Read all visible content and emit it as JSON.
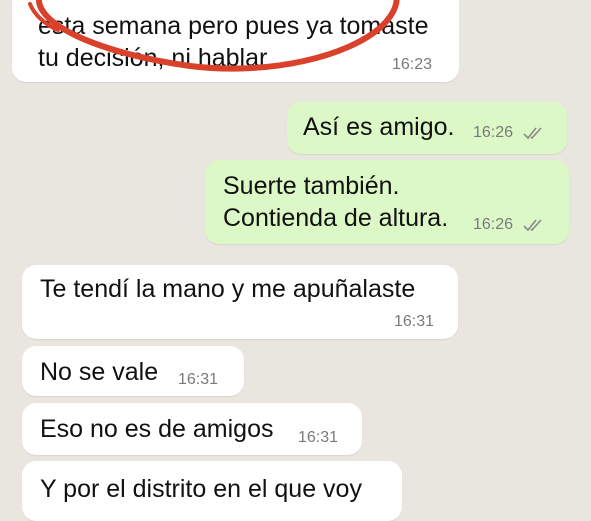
{
  "messages": [
    {
      "direction": "incoming",
      "lines": [
        "esta semana pero pues ya tomaste",
        "tu decisión, ni hablar"
      ],
      "time": "16:23"
    },
    {
      "direction": "outgoing",
      "lines": [
        "Así es amigo."
      ],
      "time": "16:26",
      "status": "read-checks"
    },
    {
      "direction": "outgoing",
      "lines": [
        "Suerte también.",
        "Contienda de altura."
      ],
      "time": "16:26",
      "status": "read-checks"
    },
    {
      "direction": "incoming",
      "lines": [
        "Te tendí la mano y me apuñalaste"
      ],
      "time": "16:31"
    },
    {
      "direction": "incoming",
      "lines": [
        "No se vale"
      ],
      "time": "16:31"
    },
    {
      "direction": "incoming",
      "lines": [
        "Eso no es de amigos"
      ],
      "time": "16:31"
    },
    {
      "direction": "incoming",
      "lines": [
        "Y por el distrito en el que voy"
      ],
      "time": ""
    }
  ],
  "colors": {
    "chat_background": "#e9e6df",
    "incoming_bubble": "#ffffff",
    "outgoing_bubble": "#dcf8c6",
    "annotation_circle": "#d9412b",
    "timestamp": "#7a7a7a",
    "check_marks": "#8a8a8a"
  }
}
